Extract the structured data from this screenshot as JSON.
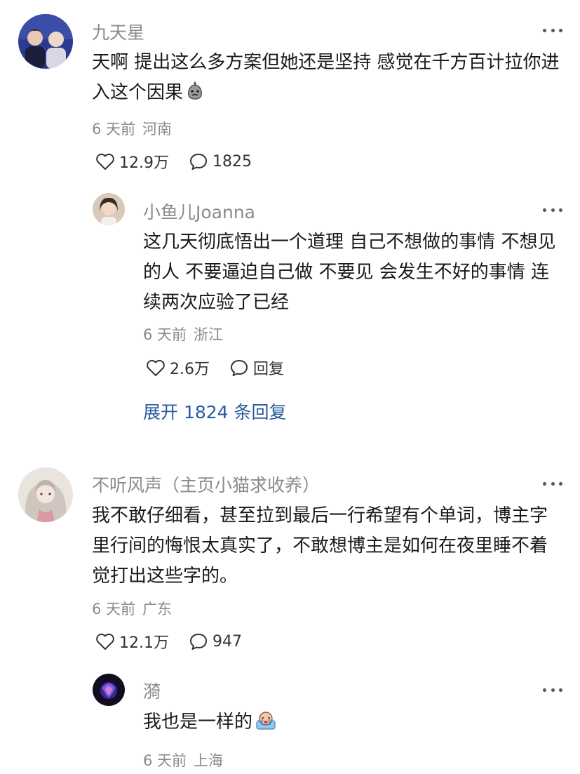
{
  "comments": [
    {
      "author": "九天星",
      "text": "天啊 提出这么多方案但她还是坚持 感觉在千方百计拉你进入这个因果",
      "time": "6 天前",
      "location": "河南",
      "likes": "12.9万",
      "replies": "1825",
      "replies_list": [
        {
          "author": "小鱼儿Joanna",
          "text": "这几天彻底悟出一个道理 自己不想做的事情 不想见的人 不要逼迫自己做 不要见 会发生不好的事情 连续两次应验了已经",
          "time": "6 天前",
          "location": "浙江",
          "likes": "2.6万",
          "reply_label": "回复"
        }
      ],
      "expand_label": "展开 1824 条回复"
    },
    {
      "author": "不听风声（主页小猫求收养）",
      "text": "我不敢仔细看，甚至拉到最后一行希望有个单词，博主字里行间的悔恨太真实了，不敢想博主是如何在夜里睡不着觉打出这些字的。",
      "time": "6 天前",
      "location": "广东",
      "likes": "12.1万",
      "replies": "947",
      "replies_list": [
        {
          "author": "漪",
          "text": "我也是一样的",
          "time": "6 天前",
          "location": "上海"
        }
      ]
    }
  ],
  "icons": {
    "like": "heart-outline-icon",
    "comment": "speech-bubble-icon",
    "more": "more-dots-icon"
  },
  "colors": {
    "link": "#285a9e",
    "meta": "#8a8a8a"
  }
}
